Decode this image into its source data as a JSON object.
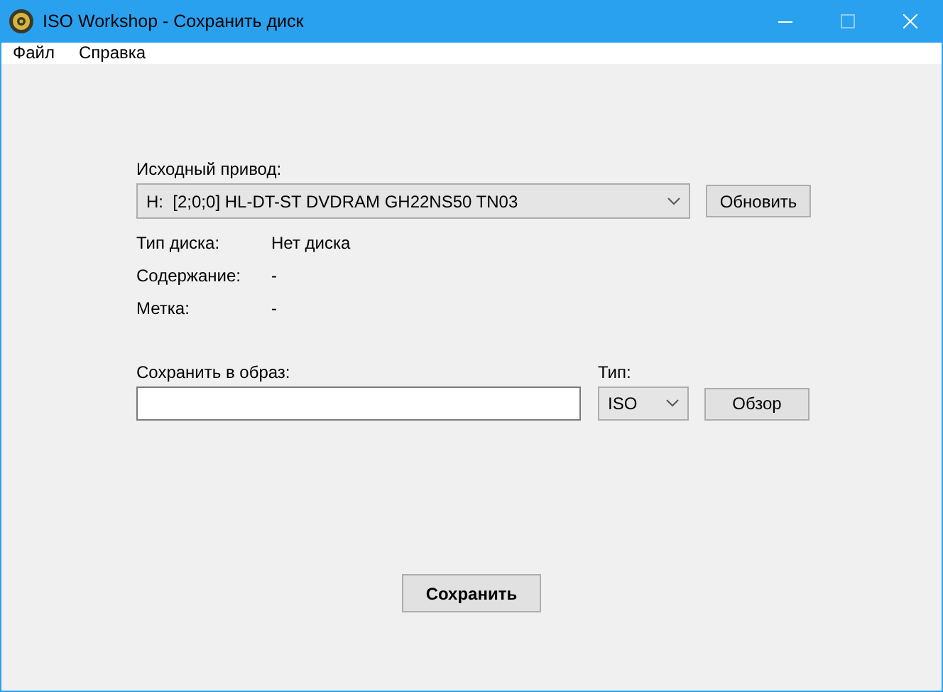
{
  "window": {
    "title": "ISO Workshop - Сохранить диск",
    "controls": [
      {
        "kind": "minimize",
        "disabled": false
      },
      {
        "kind": "maximize",
        "disabled": true
      },
      {
        "kind": "close",
        "disabled": false
      }
    ]
  },
  "menu": [
    {
      "label": "Файл"
    },
    {
      "label": "Справка"
    }
  ],
  "source": {
    "label": "Исходный привод:",
    "value": "H:  [2;0;0] HL-DT-ST DVDRAM GH22NS50 TN03",
    "button": "Обновить"
  },
  "info": [
    {
      "label": "Тип диска:",
      "value": "Нет диска"
    },
    {
      "label": "Содержание:",
      "value": "-"
    },
    {
      "label": "Метка:",
      "value": "-"
    }
  ],
  "target": {
    "label": "Сохранить в образ:",
    "type_label": "Тип:",
    "type_value": "ISO",
    "button": "Обзор"
  },
  "save_button": "Сохранить"
}
